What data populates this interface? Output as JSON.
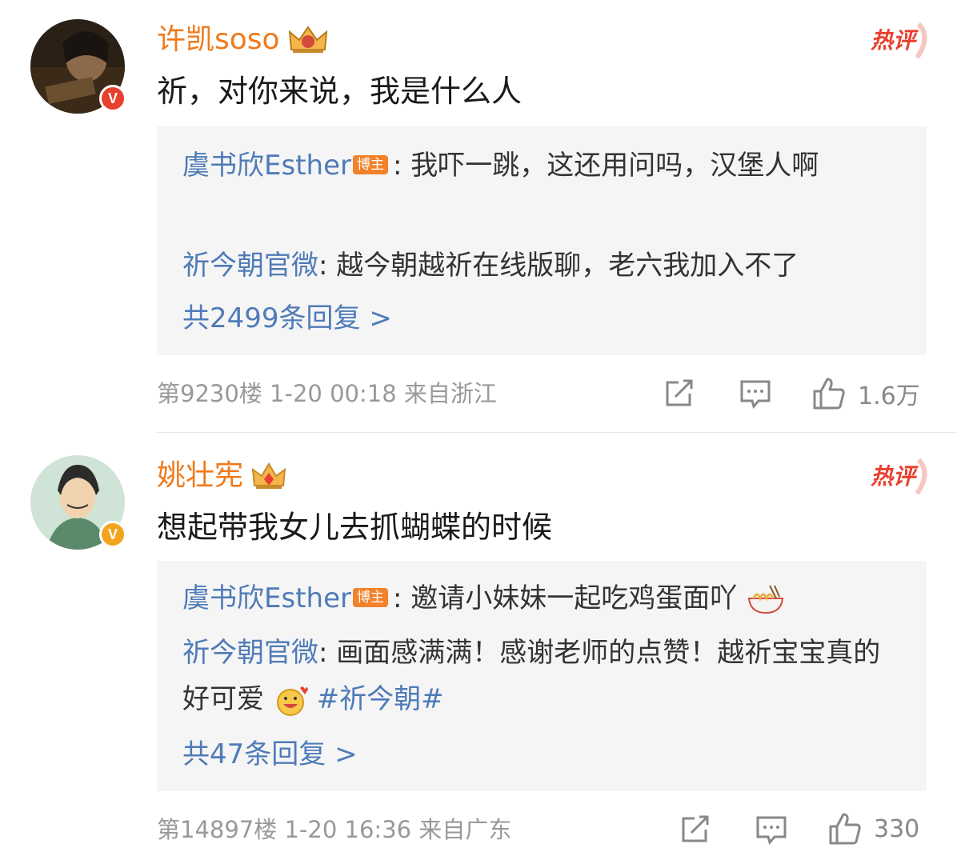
{
  "comments": [
    {
      "username": "许凯soso",
      "hot_label": "热评",
      "text": "祈，对你来说，我是什么人",
      "replies": [
        {
          "name": "虞书欣Esther",
          "tag": "博主",
          "sep": ": ",
          "text": "我吓一跳，这还用问吗，汉堡人啊"
        },
        {
          "name": "祈今朝官微",
          "sep": ": ",
          "text": "越今朝越祈在线版聊，老六我加入不了"
        }
      ],
      "more": "共2499条回复 >",
      "floor": "第9230楼",
      "time": "1-20 00:18",
      "location": "来自浙江",
      "likes": "1.6万"
    },
    {
      "username": "姚壮宪",
      "hot_label": "热评",
      "text": "想起带我女儿去抓蝴蝶的时候",
      "replies": [
        {
          "name": "虞书欣Esther",
          "tag": "博主",
          "sep": ": ",
          "text": "邀请小妹妹一起吃鸡蛋面吖"
        },
        {
          "name": "祈今朝官微",
          "sep": ": ",
          "text": "画面感满满！感谢老师的点赞！越祈宝宝真的好可爱",
          "hashtag": "#祈今朝#"
        }
      ],
      "more": "共47条回复 >",
      "floor": "第14897楼",
      "time": "1-20 16:36",
      "location": "来自广东",
      "likes": "330"
    }
  ],
  "icons": [
    "share-icon",
    "comment-icon",
    "like-icon",
    "crown-icon",
    "verified-icon",
    "noodle-emoji-icon",
    "smile-emoji-icon"
  ],
  "colors": {
    "username": "#f07a1c",
    "link": "#4f7bb8",
    "hot": "#e8402f",
    "reply_bg": "#f5f5f5",
    "meta": "#999999"
  }
}
